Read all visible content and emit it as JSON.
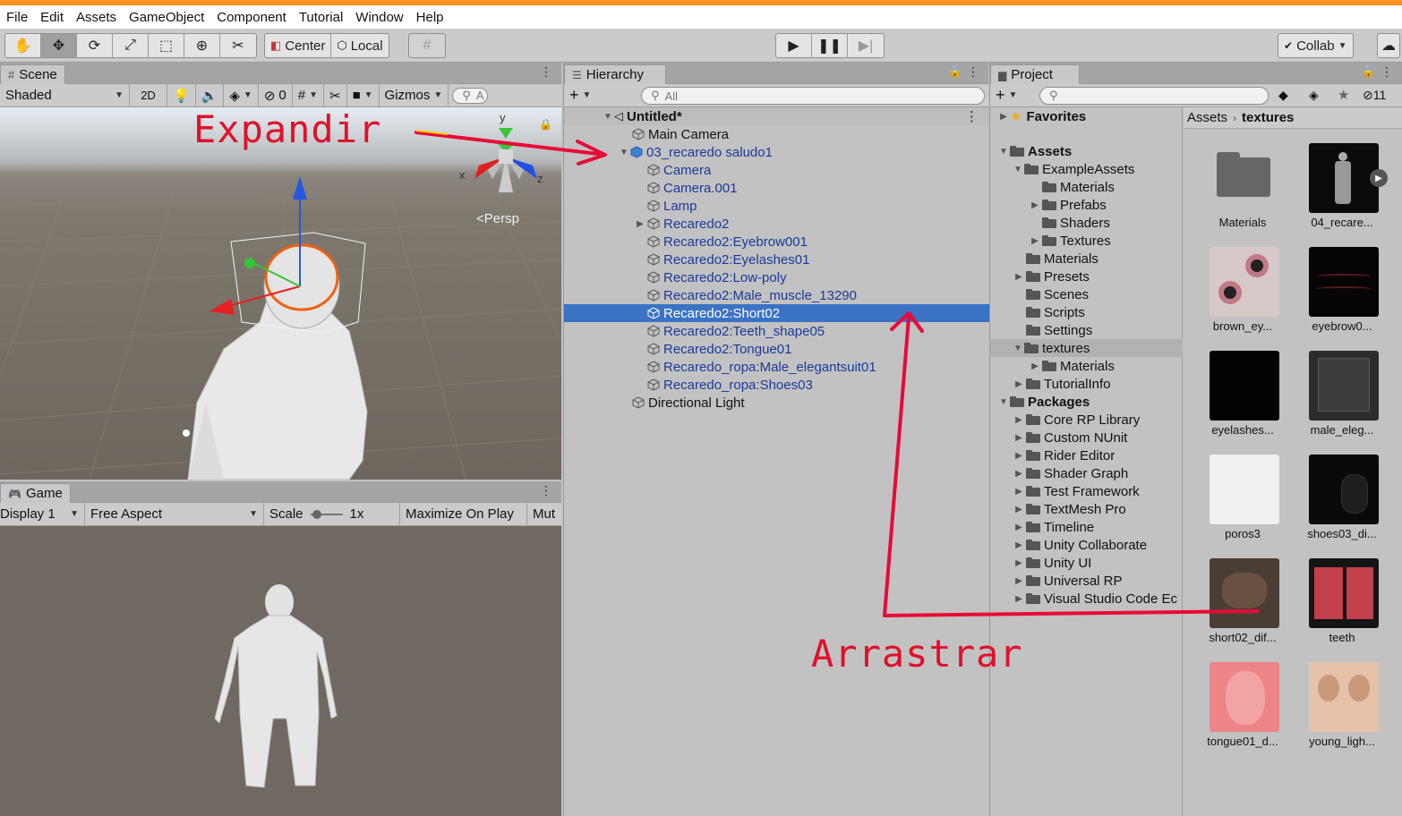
{
  "menu": [
    "File",
    "Edit",
    "Assets",
    "GameObject",
    "Component",
    "Tutorial",
    "Window",
    "Help"
  ],
  "toolbar": {
    "center_label": "Center",
    "local_label": "Local",
    "collab_label": "Collab"
  },
  "scene": {
    "tab_label": "Scene",
    "shading_mode": "Shaded",
    "mode_2d": "2D",
    "hidden_count": "0",
    "gizmos_label": "Gizmos",
    "search_placeholder": "A",
    "persp_label": "Persp",
    "axis_y": "y",
    "axis_x": "x",
    "axis_z": "z"
  },
  "game": {
    "tab_label": "Game",
    "display": "Display 1",
    "aspect": "Free Aspect",
    "scale_label": "Scale",
    "scale_value": "1x",
    "maximize_label": "Maximize On Play",
    "mute_label": "Mut"
  },
  "hierarchy": {
    "tab_label": "Hierarchy",
    "search_placeholder": "All",
    "scene_name": "Untitled*",
    "items": [
      {
        "label": "Main Camera"
      },
      {
        "label": "03_recaredo saludo1"
      },
      {
        "label": "Camera"
      },
      {
        "label": "Camera.001"
      },
      {
        "label": "Lamp"
      },
      {
        "label": "Recaredo2"
      },
      {
        "label": "Recaredo2:Eyebrow001"
      },
      {
        "label": "Recaredo2:Eyelashes01"
      },
      {
        "label": "Recaredo2:Low-poly"
      },
      {
        "label": "Recaredo2:Male_muscle_13290"
      },
      {
        "label": "Recaredo2:Short02"
      },
      {
        "label": "Recaredo2:Teeth_shape05"
      },
      {
        "label": "Recaredo2:Tongue01"
      },
      {
        "label": "Recaredo_ropa:Male_elegantsuit01"
      },
      {
        "label": "Recaredo_ropa:Shoes03"
      },
      {
        "label": "Directional Light"
      }
    ]
  },
  "project": {
    "tab_label": "Project",
    "hidden_count": "11",
    "favorites_label": "Favorites",
    "tree": [
      {
        "label": "Assets"
      },
      {
        "label": "ExampleAssets"
      },
      {
        "label": "Materials"
      },
      {
        "label": "Prefabs"
      },
      {
        "label": "Shaders"
      },
      {
        "label": "Textures"
      },
      {
        "label": "Materials"
      },
      {
        "label": "Presets"
      },
      {
        "label": "Scenes"
      },
      {
        "label": "Scripts"
      },
      {
        "label": "Settings"
      },
      {
        "label": "textures"
      },
      {
        "label": "Materials"
      },
      {
        "label": "TutorialInfo"
      },
      {
        "label": "Packages"
      },
      {
        "label": "Core RP Library"
      },
      {
        "label": "Custom NUnit"
      },
      {
        "label": "Rider Editor"
      },
      {
        "label": "Shader Graph"
      },
      {
        "label": "Test Framework"
      },
      {
        "label": "TextMesh Pro"
      },
      {
        "label": "Timeline"
      },
      {
        "label": "Unity Collaborate"
      },
      {
        "label": "Unity UI"
      },
      {
        "label": "Universal RP"
      },
      {
        "label": "Visual Studio Code Ec"
      }
    ],
    "breadcrumb_root": "Assets",
    "breadcrumb_current": "textures",
    "assets": [
      {
        "label": "Materials"
      },
      {
        "label": "04_recare..."
      },
      {
        "label": "brown_ey..."
      },
      {
        "label": "eyebrow0..."
      },
      {
        "label": "eyelashes..."
      },
      {
        "label": "male_eleg..."
      },
      {
        "label": "poros3"
      },
      {
        "label": "shoes03_di..."
      },
      {
        "label": "short02_dif..."
      },
      {
        "label": "teeth"
      },
      {
        "label": "tongue01_d..."
      },
      {
        "label": "young_ligh..."
      }
    ]
  },
  "annotations": {
    "expand": "Expandir",
    "drag": "Arrastrar"
  }
}
